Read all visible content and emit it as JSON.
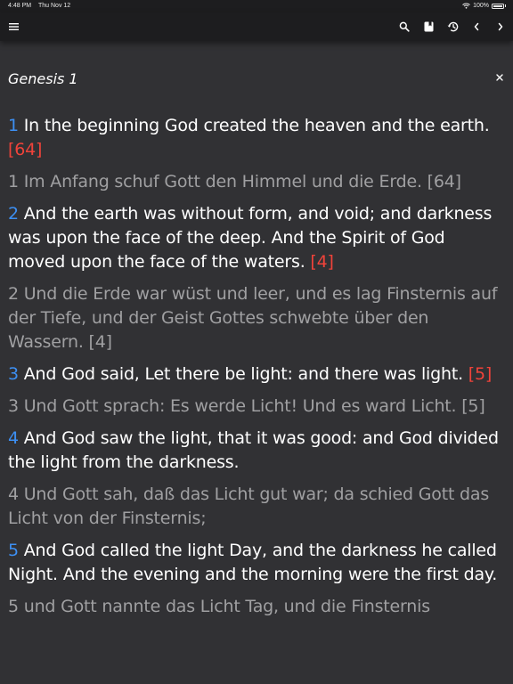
{
  "status_bar": {
    "time": "4:48 PM",
    "date": "Thu Nov 12",
    "battery": "100%"
  },
  "toolbar": {
    "menu_icon": "hamburger-menu-icon",
    "search_icon": "search-icon",
    "book_icon": "bookmark-book-icon",
    "history_icon": "history-clock-icon",
    "prev_icon": "chevron-left-icon",
    "next_icon": "chevron-right-icon"
  },
  "chapter": {
    "title": "Genesis 1",
    "close_label": "×"
  },
  "colors": {
    "background": "#313134",
    "toolbar": "#1d1d1f",
    "verse_number": "#3d8ff2",
    "reference": "#f0433a",
    "secondary_text": "#a0a0a2"
  },
  "verses": [
    {
      "num": "1",
      "en_text": " In the beginning God created the heaven and the earth. ",
      "en_ref": "[64]",
      "de_text": "1 Im Anfang schuf Gott den Himmel und die Erde. [64]"
    },
    {
      "num": "2",
      "en_text": " And the earth was without form, and void; and darkness was upon the face of the deep. And the Spirit of God moved upon the face of the waters. ",
      "en_ref": "[4]",
      "de_text": "2 Und die Erde war wüst und leer, und es lag Finsternis auf der Tiefe, und der Geist Gottes schwebte über den Wassern. [4]"
    },
    {
      "num": "3",
      "en_text": " And God said, Let there be light: and there was light. ",
      "en_ref": "[5]",
      "de_text": "3 Und Gott sprach: Es werde Licht! Und es ward Licht. [5]"
    },
    {
      "num": "4",
      "en_text": " And God saw the light, that it was good: and God divided the light from the darkness.",
      "en_ref": "",
      "de_text": "4 Und Gott sah, daß das Licht gut war; da schied Gott das Licht von der Finsternis;"
    },
    {
      "num": "5",
      "en_text": " And God called the light Day, and the darkness he called Night. And the evening and the morning were the first day.",
      "en_ref": "",
      "de_text": "5 und Gott nannte das Licht Tag, und die Finsternis"
    }
  ]
}
